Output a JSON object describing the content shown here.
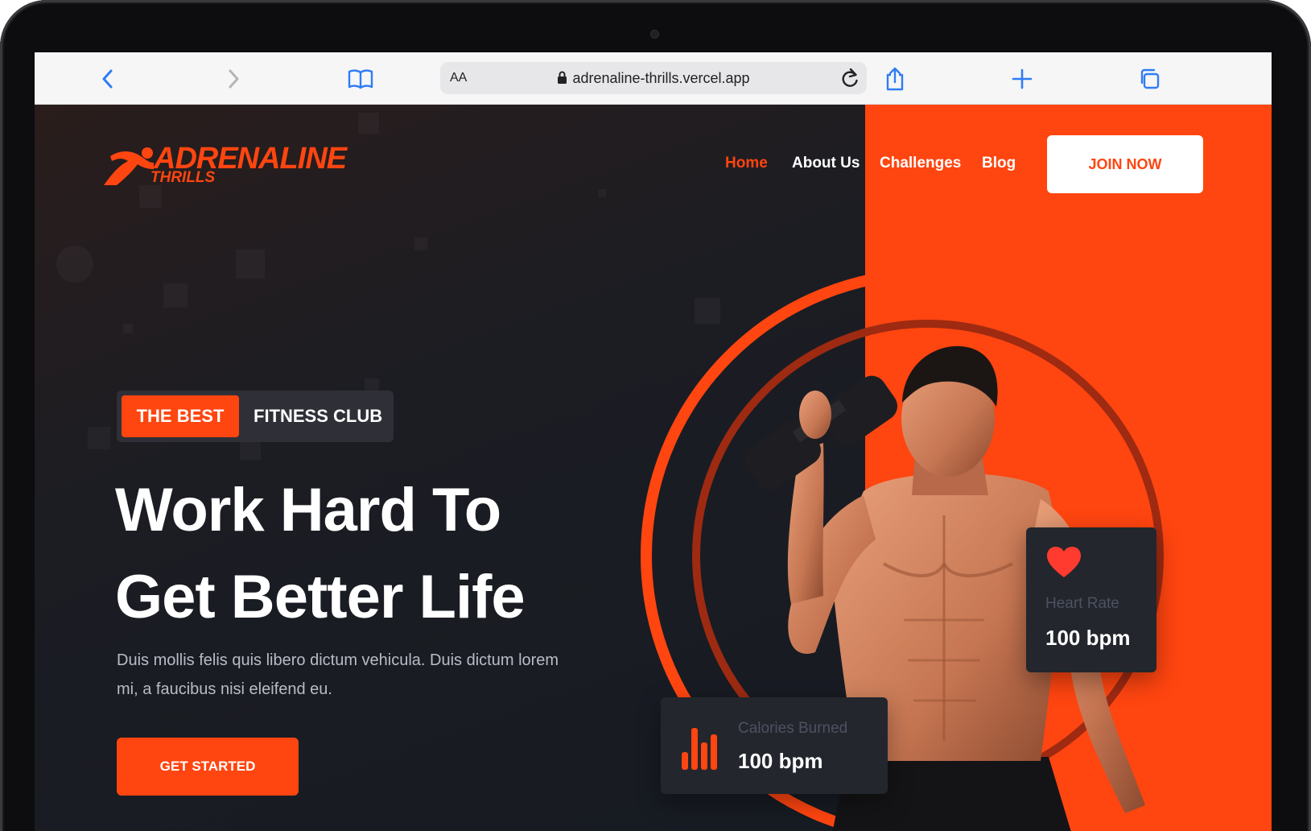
{
  "browser": {
    "url": "adrenaline-thrills.vercel.app",
    "text_size_label": "AA",
    "icons": [
      "back-icon",
      "forward-icon",
      "bookmarks-icon",
      "lock-icon",
      "reload-icon",
      "share-icon",
      "new-tab-icon",
      "tabs-icon"
    ]
  },
  "header": {
    "logo_line1": "ADRENALINE",
    "logo_line2": "THRILLS",
    "nav": [
      "Home",
      "About Us",
      "Challenges",
      "Blog"
    ],
    "active_nav": "Home",
    "join_label": "JOIN NOW"
  },
  "hero": {
    "badge_highlight": "THE BEST",
    "badge_text": "FITNESS CLUB",
    "headline_line1": "Work Hard To",
    "headline_line2": "Get Better Life",
    "description_line1": "Duis mollis felis quis libero dictum vehicula. Duis dictum lorem",
    "description_line2": "mi, a faucibus nisi eleifend eu.",
    "cta_label": "GET STARTED"
  },
  "stats": {
    "heart": {
      "label": "Heart Rate",
      "value": "100 bpm",
      "icon": "heart-icon"
    },
    "calories": {
      "label": "Calories Burned",
      "value": "100 bpm",
      "icon": "bar-chart-icon"
    }
  },
  "colors": {
    "accent": "#ff4510",
    "dark": "#151a22",
    "card": "#23262d"
  }
}
